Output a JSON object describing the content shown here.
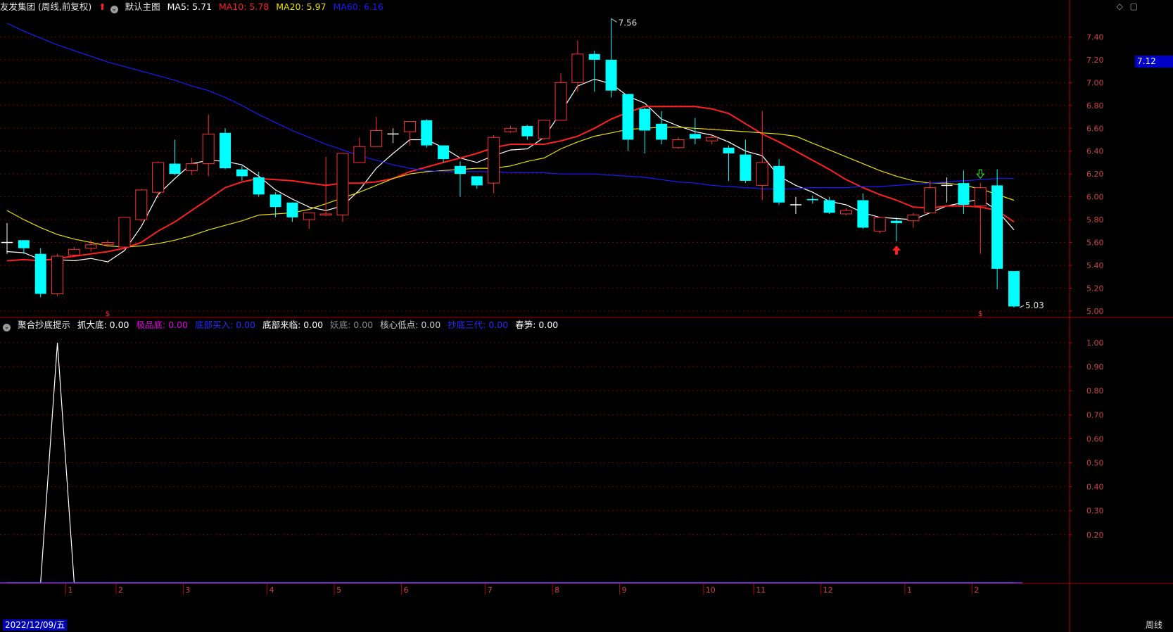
{
  "header": {
    "stock_title": "友发集团 (周线,前复权)",
    "main_chart_name": "默认主图",
    "ma5": {
      "label": "MA5:",
      "value": "5.71",
      "color": "#ffffff"
    },
    "ma10": {
      "label": "MA10:",
      "value": "5.78",
      "color": "#ff2020"
    },
    "ma20": {
      "label": "MA20:",
      "value": "5.97",
      "color": "#e8e000"
    },
    "ma60": {
      "label": "MA60:",
      "value": "6.16",
      "color": "#1a1aff"
    }
  },
  "indicator": {
    "name": "聚合抄底提示",
    "items": [
      {
        "label": "抓大底:",
        "value": "0.00",
        "color": "#ffffff"
      },
      {
        "label": "极品底:",
        "value": "0.00",
        "color": "#e000e0"
      },
      {
        "label": "底部买入:",
        "value": "0.00",
        "color": "#2a2aff"
      },
      {
        "label": "底部来临:",
        "value": "0.00",
        "color": "#ffffff"
      },
      {
        "label": "妖底:",
        "value": "0.00",
        "color": "#888888"
      },
      {
        "label": "核心低点:",
        "value": "0.00",
        "color": "#cccccc"
      },
      {
        "label": "抄底三代:",
        "value": "0.00",
        "color": "#2a2aff"
      },
      {
        "label": "春笋:",
        "value": "0.00",
        "color": "#ffffff"
      }
    ]
  },
  "price_tag": "7.12",
  "cursor_date": "2022/12/09/五",
  "cycle_label": "周线",
  "high_label": "7.56",
  "low_label": "5.03",
  "colors": {
    "up": "#ff3232",
    "down": "#00ffff",
    "axis": "#b00000",
    "grid": "#7a0000",
    "text_axis": "#cc4444"
  },
  "chart_data": [
    {
      "type": "candlestick",
      "ylim": [
        4.95,
        7.6
      ],
      "y_ticks": [
        "5.00",
        "5.20",
        "5.40",
        "5.60",
        "5.80",
        "6.00",
        "6.20",
        "6.40",
        "6.60",
        "6.80",
        "7.00",
        "7.20",
        "7.40"
      ],
      "x_month_labels": [
        {
          "label": "1",
          "index": 4
        },
        {
          "label": "2",
          "index": 7
        },
        {
          "label": "3",
          "index": 11
        },
        {
          "label": "4",
          "index": 16
        },
        {
          "label": "5",
          "index": 20
        },
        {
          "label": "6",
          "index": 24
        },
        {
          "label": "7",
          "index": 29
        },
        {
          "label": "8",
          "index": 33
        },
        {
          "label": "9",
          "index": 37
        },
        {
          "label": "10",
          "index": 42
        },
        {
          "label": "11",
          "index": 45
        },
        {
          "label": "12",
          "index": 49
        },
        {
          "label": "1",
          "index": 54
        },
        {
          "label": "2",
          "index": 58
        }
      ],
      "candles": [
        {
          "o": 5.6,
          "c": 5.6,
          "h": 5.77,
          "l": 5.5
        },
        {
          "o": 5.62,
          "c": 5.55,
          "h": 5.62,
          "l": 5.5
        },
        {
          "o": 5.5,
          "c": 5.15,
          "h": 5.55,
          "l": 5.12
        },
        {
          "o": 5.15,
          "c": 5.48,
          "h": 5.5,
          "l": 5.13
        },
        {
          "o": 5.49,
          "c": 5.54,
          "h": 5.56,
          "l": 5.48
        },
        {
          "o": 5.55,
          "c": 5.58,
          "h": 5.62,
          "l": 5.52
        },
        {
          "o": 5.58,
          "c": 5.6,
          "h": 5.62,
          "l": 5.56
        },
        {
          "o": 5.56,
          "c": 5.82,
          "h": 5.82,
          "l": 5.55
        },
        {
          "o": 5.8,
          "c": 6.06,
          "h": 6.07,
          "l": 5.78
        },
        {
          "o": 6.04,
          "c": 6.3,
          "h": 6.31,
          "l": 5.99
        },
        {
          "o": 6.29,
          "c": 6.2,
          "h": 6.5,
          "l": 6.19
        },
        {
          "o": 6.23,
          "c": 6.29,
          "h": 6.34,
          "l": 6.19
        },
        {
          "o": 6.29,
          "c": 6.55,
          "h": 6.72,
          "l": 6.18
        },
        {
          "o": 6.56,
          "c": 6.25,
          "h": 6.6,
          "l": 6.24
        },
        {
          "o": 6.24,
          "c": 6.18,
          "h": 6.27,
          "l": 6.14
        },
        {
          "o": 6.17,
          "c": 6.02,
          "h": 6.22,
          "l": 6.0
        },
        {
          "o": 6.02,
          "c": 5.91,
          "h": 6.04,
          "l": 5.82
        },
        {
          "o": 5.95,
          "c": 5.82,
          "h": 5.95,
          "l": 5.78
        },
        {
          "o": 5.8,
          "c": 5.86,
          "h": 5.86,
          "l": 5.72
        },
        {
          "o": 5.84,
          "c": 5.85,
          "h": 6.35,
          "l": 5.83
        },
        {
          "o": 5.84,
          "c": 6.38,
          "h": 6.38,
          "l": 5.78
        },
        {
          "o": 6.3,
          "c": 6.44,
          "h": 6.52,
          "l": 6.3
        },
        {
          "o": 6.44,
          "c": 6.58,
          "h": 6.7,
          "l": 6.44
        },
        {
          "o": 6.55,
          "c": 6.55,
          "h": 6.6,
          "l": 6.47
        },
        {
          "o": 6.57,
          "c": 6.66,
          "h": 6.66,
          "l": 6.45
        },
        {
          "o": 6.67,
          "c": 6.45,
          "h": 6.68,
          "l": 6.43
        },
        {
          "o": 6.45,
          "c": 6.33,
          "h": 6.45,
          "l": 6.3
        },
        {
          "o": 6.27,
          "c": 6.2,
          "h": 6.31,
          "l": 6.0
        },
        {
          "o": 6.18,
          "c": 6.1,
          "h": 6.18,
          "l": 6.07
        },
        {
          "o": 6.12,
          "c": 6.52,
          "h": 6.54,
          "l": 6.03
        },
        {
          "o": 6.57,
          "c": 6.6,
          "h": 6.62,
          "l": 6.56
        },
        {
          "o": 6.62,
          "c": 6.53,
          "h": 6.63,
          "l": 6.5
        },
        {
          "o": 6.51,
          "c": 6.67,
          "h": 6.67,
          "l": 6.5
        },
        {
          "o": 6.67,
          "c": 7.0,
          "h": 7.08,
          "l": 6.67
        },
        {
          "o": 7.0,
          "c": 7.25,
          "h": 7.37,
          "l": 6.92
        },
        {
          "o": 7.25,
          "c": 7.2,
          "h": 7.28,
          "l": 6.92
        },
        {
          "o": 7.2,
          "c": 6.93,
          "h": 7.56,
          "l": 6.87
        },
        {
          "o": 6.9,
          "c": 6.5,
          "h": 6.9,
          "l": 6.4
        },
        {
          "o": 6.77,
          "c": 6.58,
          "h": 6.78,
          "l": 6.38
        },
        {
          "o": 6.64,
          "c": 6.5,
          "h": 6.75,
          "l": 6.46
        },
        {
          "o": 6.43,
          "c": 6.5,
          "h": 6.52,
          "l": 6.42
        },
        {
          "o": 6.55,
          "c": 6.51,
          "h": 6.69,
          "l": 6.46
        },
        {
          "o": 6.49,
          "c": 6.52,
          "h": 6.55,
          "l": 6.46
        },
        {
          "o": 6.43,
          "c": 6.38,
          "h": 6.45,
          "l": 6.14
        },
        {
          "o": 6.37,
          "c": 6.14,
          "h": 6.5,
          "l": 6.12
        },
        {
          "o": 6.1,
          "c": 6.3,
          "h": 6.75,
          "l": 5.97
        },
        {
          "o": 6.27,
          "c": 5.95,
          "h": 6.33,
          "l": 5.93
        },
        {
          "o": 5.93,
          "c": 5.93,
          "h": 6.0,
          "l": 5.85
        },
        {
          "o": 5.98,
          "c": 5.97,
          "h": 6.01,
          "l": 5.94
        },
        {
          "o": 5.97,
          "c": 5.86,
          "h": 6.0,
          "l": 5.85
        },
        {
          "o": 5.85,
          "c": 5.88,
          "h": 5.9,
          "l": 5.84
        },
        {
          "o": 5.97,
          "c": 5.73,
          "h": 6.03,
          "l": 5.72
        },
        {
          "o": 5.7,
          "c": 5.82,
          "h": 5.82,
          "l": 5.68
        },
        {
          "o": 5.79,
          "c": 5.77,
          "h": 5.82,
          "l": 5.61
        },
        {
          "o": 5.79,
          "c": 5.84,
          "h": 5.86,
          "l": 5.73
        },
        {
          "o": 5.86,
          "c": 6.08,
          "h": 6.14,
          "l": 5.86
        },
        {
          "o": 6.1,
          "c": 6.1,
          "h": 6.17,
          "l": 5.95
        },
        {
          "o": 6.12,
          "c": 5.93,
          "h": 6.23,
          "l": 5.85
        },
        {
          "o": 5.92,
          "c": 6.08,
          "h": 6.12,
          "l": 5.5
        },
        {
          "o": 6.1,
          "c": 5.37,
          "h": 6.24,
          "l": 5.19
        },
        {
          "o": 5.35,
          "c": 5.04,
          "h": 5.35,
          "l": 5.03
        }
      ],
      "series": [
        {
          "name": "MA5",
          "color": "#ffffff",
          "values": [
            5.52,
            5.51,
            5.45,
            5.45,
            5.44,
            5.46,
            5.43,
            5.53,
            5.74,
            6.02,
            6.16,
            6.29,
            6.32,
            6.31,
            6.28,
            6.18,
            6.06,
            5.98,
            5.91,
            5.88,
            5.92,
            6.06,
            6.25,
            6.38,
            6.5,
            6.5,
            6.43,
            6.34,
            6.3,
            6.36,
            6.41,
            6.42,
            6.52,
            6.74,
            6.97,
            7.03,
            6.99,
            6.88,
            6.82,
            6.68,
            6.62,
            6.57,
            6.54,
            6.48,
            6.4,
            6.36,
            6.18,
            6.1,
            6.04,
            5.96,
            5.93,
            5.86,
            5.82,
            5.81,
            5.8,
            5.86,
            5.92,
            5.95,
            5.98,
            5.88,
            5.71
          ]
        },
        {
          "name": "MA10",
          "color": "#ff2020",
          "values": [
            5.44,
            5.45,
            5.44,
            5.46,
            5.48,
            5.5,
            5.52,
            5.55,
            5.6,
            5.7,
            5.78,
            5.88,
            5.98,
            6.08,
            6.13,
            6.16,
            6.15,
            6.14,
            6.12,
            6.1,
            6.12,
            6.12,
            6.13,
            6.16,
            6.22,
            6.26,
            6.3,
            6.34,
            6.38,
            6.43,
            6.46,
            6.46,
            6.46,
            6.49,
            6.53,
            6.6,
            6.68,
            6.74,
            6.79,
            6.79,
            6.79,
            6.79,
            6.77,
            6.73,
            6.64,
            6.55,
            6.48,
            6.4,
            6.32,
            6.24,
            6.15,
            6.08,
            6.02,
            5.97,
            5.91,
            5.9,
            5.92,
            5.92,
            5.91,
            5.88,
            5.78
          ]
        },
        {
          "name": "MA20",
          "color": "#e8e000",
          "values": [
            5.88,
            5.8,
            5.73,
            5.67,
            5.63,
            5.6,
            5.57,
            5.56,
            5.57,
            5.59,
            5.62,
            5.66,
            5.71,
            5.75,
            5.79,
            5.84,
            5.85,
            5.86,
            5.89,
            5.94,
            5.99,
            6.04,
            6.1,
            6.16,
            6.2,
            6.22,
            6.23,
            6.24,
            6.25,
            6.25,
            6.27,
            6.31,
            6.34,
            6.42,
            6.48,
            6.53,
            6.56,
            6.59,
            6.6,
            6.61,
            6.61,
            6.6,
            6.59,
            6.58,
            6.57,
            6.56,
            6.55,
            6.53,
            6.47,
            6.41,
            6.35,
            6.29,
            6.23,
            6.18,
            6.14,
            6.12,
            6.12,
            6.1,
            6.07,
            6.02,
            5.97
          ]
        },
        {
          "name": "MA60",
          "color": "#1a1aff",
          "values": [
            7.52,
            7.45,
            7.39,
            7.33,
            7.28,
            7.23,
            7.18,
            7.14,
            7.1,
            7.06,
            7.02,
            6.97,
            6.93,
            6.87,
            6.8,
            6.72,
            6.65,
            6.58,
            6.52,
            6.46,
            6.41,
            6.36,
            6.32,
            6.28,
            6.25,
            6.23,
            6.22,
            6.22,
            6.22,
            6.22,
            6.21,
            6.21,
            6.21,
            6.2,
            6.2,
            6.2,
            6.19,
            6.18,
            6.17,
            6.15,
            6.13,
            6.12,
            6.1,
            6.09,
            6.08,
            6.07,
            6.07,
            6.07,
            6.08,
            6.08,
            6.08,
            6.09,
            6.09,
            6.1,
            6.11,
            6.12,
            6.13,
            6.14,
            6.15,
            6.16,
            6.16
          ]
        }
      ],
      "markers": [
        {
          "index": 6,
          "type": "s-up"
        },
        {
          "index": 53,
          "type": "arrow-up"
        },
        {
          "index": 58,
          "type": "arrow-down"
        },
        {
          "index": 58,
          "type": "s-up"
        }
      ]
    },
    {
      "type": "line",
      "ylim": [
        0,
        1.05
      ],
      "y_ticks": [
        "0.20",
        "0.30",
        "0.40",
        "0.50",
        "0.60",
        "0.70",
        "0.80",
        "0.90",
        "1.00"
      ],
      "series": [
        {
          "name": "抓大底",
          "color": "#ffffff",
          "values": [
            0,
            0,
            0,
            1,
            0,
            0,
            0,
            0,
            0,
            0,
            0,
            0,
            0,
            0,
            0,
            0,
            0,
            0,
            0,
            0,
            0,
            0,
            0,
            0,
            0,
            0,
            0,
            0,
            0,
            0,
            0,
            0,
            0,
            0,
            0,
            0,
            0,
            0,
            0,
            0,
            0,
            0,
            0,
            0,
            0,
            0,
            0,
            0,
            0,
            0,
            0,
            0,
            0,
            0,
            0,
            0,
            0,
            0,
            0,
            0,
            0
          ]
        }
      ]
    }
  ]
}
